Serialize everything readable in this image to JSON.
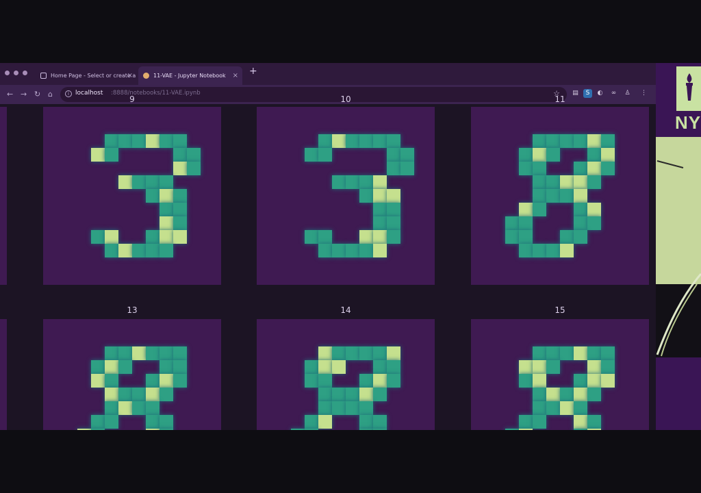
{
  "browser": {
    "tabs": [
      {
        "title": "Home Page - Select or create a",
        "active": false
      },
      {
        "title": "11-VAE - Jupyter Notebook",
        "active": true
      }
    ],
    "new_tab_symbol": "+",
    "url_host": "localhost",
    "url_path": ":8888/notebooks/11-VAE.ipynb"
  },
  "notebook": {
    "grid_titles": [
      "9",
      "10",
      "11",
      "13",
      "14",
      "15"
    ],
    "digits": [
      "3",
      "3",
      "8",
      "8",
      "8",
      "8"
    ]
  },
  "speaker": {
    "logo_text": "NY"
  },
  "colors": {
    "panel_bg": "#3f1a52",
    "digit_light": "#c5e08e",
    "digit_mid": "#2ea084",
    "digit_dark": "#1f6b78",
    "accent": "#c9e2a2"
  },
  "icons": [
    "back-icon",
    "forward-icon",
    "reload-icon",
    "home-icon",
    "info-icon",
    "star-icon",
    "extension-icon",
    "torch-icon"
  ]
}
